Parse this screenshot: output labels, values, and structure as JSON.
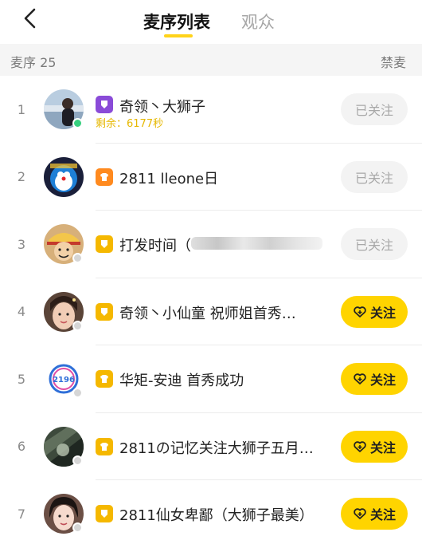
{
  "header": {
    "tabs": [
      {
        "label": "麦序列表",
        "active": true
      },
      {
        "label": "观众",
        "active": false
      }
    ]
  },
  "subbar": {
    "title": "麦序 25",
    "ban_label": "禁麦"
  },
  "colors": {
    "accent": "#ffd400",
    "online": "#37d07f",
    "offline": "#d6d6d6",
    "level_purple": "#8a4bd8",
    "level_orange": "#ff8a1f",
    "level_yellow": "#f5b800"
  },
  "queue": [
    {
      "rank": "1",
      "name": "奇领丶大狮子",
      "remain": "剩余：6177秒",
      "button": "已关注",
      "followed": true,
      "status": "online",
      "level_icon": "purple-badge-icon"
    },
    {
      "rank": "2",
      "name": "2811 lleone日",
      "button": "已关注",
      "followed": true,
      "status": "none",
      "level_icon": "orange-shirt-icon"
    },
    {
      "rank": "3",
      "name": "打发时间（",
      "button": "已关注",
      "followed": true,
      "status": "offline",
      "level_icon": "yellow-badge-icon"
    },
    {
      "rank": "4",
      "name": "奇领丶小仙童 祝师姐首秀…",
      "button": "关注",
      "followed": false,
      "status": "offline",
      "level_icon": "yellow-badge-icon"
    },
    {
      "rank": "5",
      "name": "华矩-安迪  首秀成功",
      "button": "关注",
      "followed": false,
      "status": "offline",
      "level_icon": "yellow-shirt-icon"
    },
    {
      "rank": "6",
      "name": "2811の记忆关注大狮子五月…",
      "button": "关注",
      "followed": false,
      "status": "offline",
      "level_icon": "yellow-shirt-icon"
    },
    {
      "rank": "7",
      "name": "2811仙女卑鄙（大狮子最美）",
      "button": "关注",
      "followed": false,
      "status": "offline",
      "level_icon": "yellow-badge-icon"
    }
  ]
}
